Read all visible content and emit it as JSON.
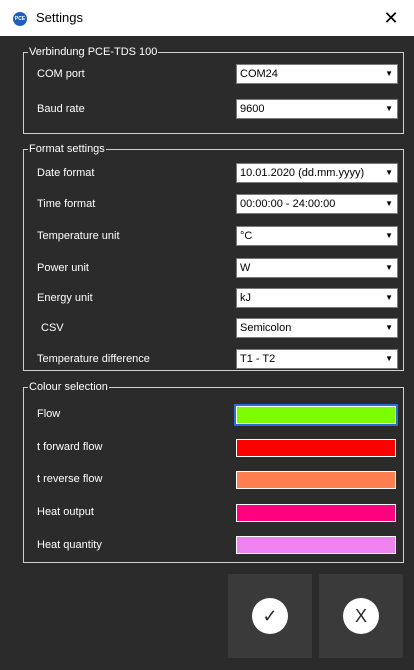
{
  "window": {
    "title": "Settings",
    "close_glyph": "✕",
    "icon_name": "pce-logo-icon",
    "icon_text": "PCE"
  },
  "connection": {
    "legend": "Verbindung PCE-TDS 100",
    "com_port_label": "COM port",
    "com_port_value": "COM24",
    "baud_rate_label": "Baud rate",
    "baud_rate_value": "9600"
  },
  "format": {
    "legend": "Format settings",
    "date_label": "Date format",
    "date_value": "10.01.2020 (dd.mm.yyyy)",
    "time_label": "Time format",
    "time_value": "00:00:00 - 24:00:00",
    "temp_label": "Temperature unit",
    "temp_value": "°C",
    "power_label": "Power unit",
    "power_value": "W",
    "energy_label": "Energy unit",
    "energy_value": "kJ",
    "csv_label": "CSV",
    "csv_value": "Semicolon",
    "tempdiff_label": "Temperature difference",
    "tempdiff_value": "T1 - T2"
  },
  "colours": {
    "legend": "Colour selection",
    "items": [
      {
        "label": "Flow",
        "color": "#7cfc00"
      },
      {
        "label": "t forward flow",
        "color": "#ff0000"
      },
      {
        "label": "t reverse flow",
        "color": "#ff7f50"
      },
      {
        "label": "Heat output",
        "color": "#ff007f"
      },
      {
        "label": "Heat quantity",
        "color": "#ee82ee"
      }
    ]
  },
  "buttons": {
    "ok_glyph": "✓",
    "cancel_glyph": "X"
  },
  "dropdown_arrow": "▼"
}
